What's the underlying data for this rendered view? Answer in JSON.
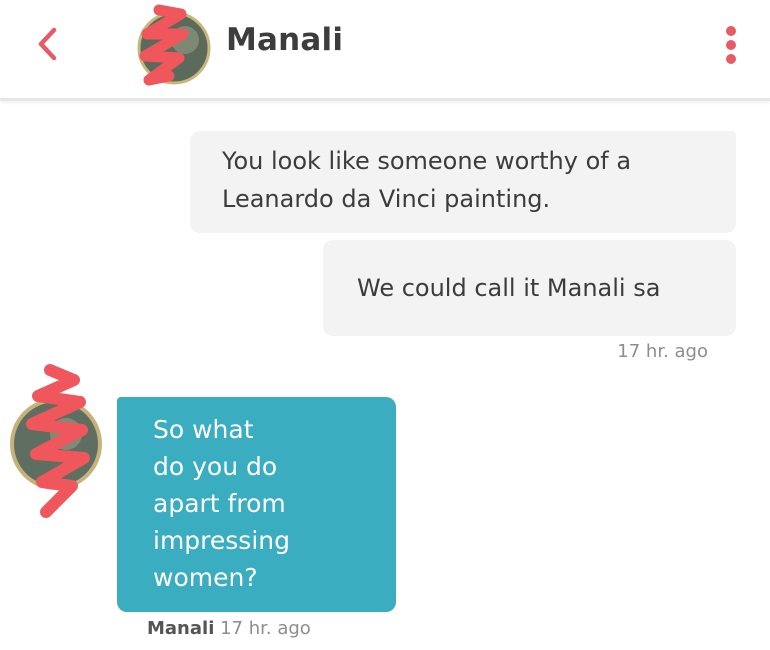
{
  "header": {
    "contact_name": "Manali",
    "back_icon": "chevron-left-icon",
    "menu_icon": "vertical-dots-icon",
    "accent_color": "#e65b65"
  },
  "messages": {
    "outgoing": [
      {
        "text_lines": [
          "You look like someone worthy of a",
          "Leanardo da Vinci painting."
        ]
      },
      {
        "text": "We could call it Manali sa"
      }
    ],
    "outgoing_time": "17 hr. ago",
    "incoming": {
      "text_lines": [
        "So what",
        "do you do",
        "apart from",
        "impressing",
        "women?"
      ],
      "bubble_color": "#3aadc1"
    },
    "incoming_sender": "Manali",
    "incoming_time": "17 hr. ago"
  }
}
